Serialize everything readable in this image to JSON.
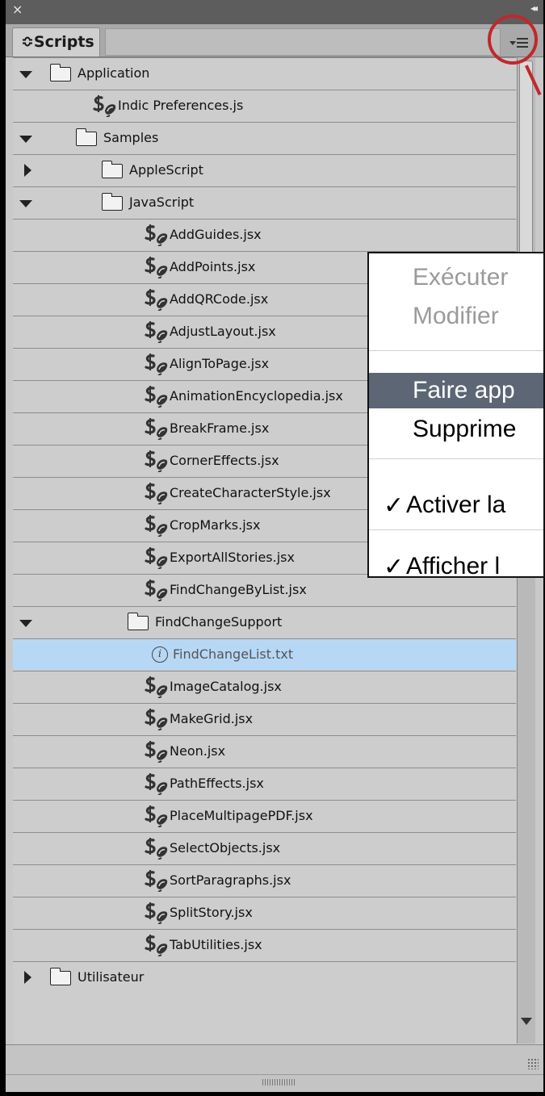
{
  "panel": {
    "close_glyph": "×",
    "collapse_glyph": "◂◂",
    "tab_label": "≎Scripts",
    "menu_icon": "panel-menu-icon"
  },
  "tree": [
    {
      "label": "Application",
      "type": "folder",
      "disclosure": "down"
    },
    {
      "label": "Indic Preferences.js",
      "type": "script"
    },
    {
      "label": "Samples",
      "type": "folder",
      "disclosure": "down"
    },
    {
      "label": "AppleScript",
      "type": "folder",
      "disclosure": "right"
    },
    {
      "label": "JavaScript",
      "type": "folder",
      "disclosure": "down"
    },
    {
      "label": "AddGuides.jsx",
      "type": "script"
    },
    {
      "label": "AddPoints.jsx",
      "type": "script"
    },
    {
      "label": "AddQRCode.jsx",
      "type": "script"
    },
    {
      "label": "AdjustLayout.jsx",
      "type": "script"
    },
    {
      "label": "AlignToPage.jsx",
      "type": "script"
    },
    {
      "label": "AnimationEncyclopedia.jsx",
      "type": "script"
    },
    {
      "label": "BreakFrame.jsx",
      "type": "script"
    },
    {
      "label": "CornerEffects.jsx",
      "type": "script"
    },
    {
      "label": "CreateCharacterStyle.jsx",
      "type": "script"
    },
    {
      "label": "CropMarks.jsx",
      "type": "script"
    },
    {
      "label": "ExportAllStories.jsx",
      "type": "script"
    },
    {
      "label": "FindChangeByList.jsx",
      "type": "script"
    },
    {
      "label": "FindChangeSupport",
      "type": "folder",
      "disclosure": "down"
    },
    {
      "label": "FindChangeList.txt",
      "type": "info",
      "selected": true
    },
    {
      "label": "ImageCatalog.jsx",
      "type": "script"
    },
    {
      "label": "MakeGrid.jsx",
      "type": "script"
    },
    {
      "label": "Neon.jsx",
      "type": "script"
    },
    {
      "label": "PathEffects.jsx",
      "type": "script"
    },
    {
      "label": "PlaceMultipagePDF.jsx",
      "type": "script"
    },
    {
      "label": "SelectObjects.jsx",
      "type": "script"
    },
    {
      "label": "SortParagraphs.jsx",
      "type": "script"
    },
    {
      "label": "SplitStory.jsx",
      "type": "script"
    },
    {
      "label": "TabUtilities.jsx",
      "type": "script"
    },
    {
      "label": "Utilisateur",
      "type": "folder",
      "disclosure": "right"
    }
  ],
  "context_menu": {
    "items": [
      {
        "label": "Exécuter",
        "state": "disabled"
      },
      {
        "label": "Modifier",
        "state": "disabled"
      },
      {
        "label": "Faire app",
        "state": "highlighted"
      },
      {
        "label": "Supprime",
        "state": "normal"
      },
      {
        "label": "Activer la",
        "state": "checked",
        "check": "✓"
      },
      {
        "label": "Afficher l",
        "state": "checked",
        "check": "✓"
      }
    ]
  },
  "colors": {
    "selection": "#b6d8f5",
    "highlight": "#5c6675",
    "callout": "#c1272d"
  }
}
